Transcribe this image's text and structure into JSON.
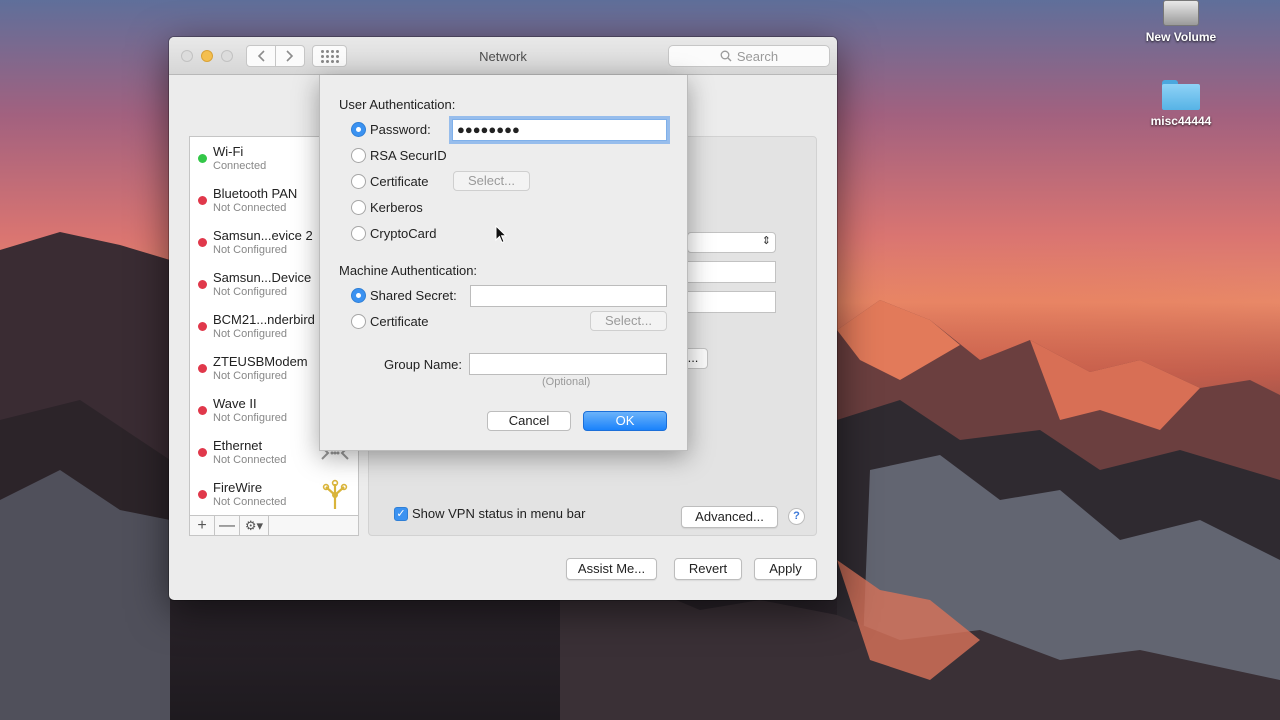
{
  "desktop": {
    "icons": [
      {
        "label": "New Volume",
        "icon": "disk-icon"
      },
      {
        "label": "misc44444",
        "icon": "folder-icon"
      }
    ]
  },
  "window": {
    "title": "Network",
    "search_placeholder": "Search"
  },
  "services": [
    {
      "name": "Wi-Fi",
      "status": "Connected",
      "color": "#33c748"
    },
    {
      "name": "Bluetooth PAN",
      "status": "Not Connected",
      "color": "#e0384b"
    },
    {
      "name": "Samsun...evice 2",
      "status": "Not Configured",
      "color": "#e0384b"
    },
    {
      "name": "Samsun...Device",
      "status": "Not Configured",
      "color": "#e0384b"
    },
    {
      "name": "BCM21...nderbird",
      "status": "Not Configured",
      "color": "#e0384b"
    },
    {
      "name": "ZTEUSBModem",
      "status": "Not Configured",
      "color": "#e0384b"
    },
    {
      "name": "Wave II",
      "status": "Not Configured",
      "color": "#e0384b"
    },
    {
      "name": "Ethernet",
      "status": "Not Connected",
      "color": "#e0384b"
    },
    {
      "name": "FireWire",
      "status": "Not Connected",
      "color": "#e0384b"
    }
  ],
  "list_toolbar": {
    "add": "+",
    "remove": "—",
    "gear": "⚙▾"
  },
  "detail": {
    "peek_button": "...",
    "show_vpn_status": "Show VPN status in menu bar",
    "show_vpn_checked": true,
    "advanced": "Advanced...",
    "help": "?"
  },
  "footer": {
    "assist": "Assist Me...",
    "revert": "Revert",
    "apply": "Apply"
  },
  "sheet": {
    "user_auth_title": "User Authentication:",
    "user_options": [
      {
        "label": "Password:",
        "selected": true
      },
      {
        "label": "RSA SecurID",
        "selected": false
      },
      {
        "label": "Certificate",
        "selected": false
      },
      {
        "label": "Kerberos",
        "selected": false
      },
      {
        "label": "CryptoCard",
        "selected": false
      }
    ],
    "password_value": "●●●●●●●●",
    "user_cert_select": "Select...",
    "machine_auth_title": "Machine Authentication:",
    "machine_options": [
      {
        "label": "Shared Secret:",
        "selected": true
      },
      {
        "label": "Certificate",
        "selected": false
      }
    ],
    "shared_secret_value": "",
    "machine_cert_select": "Select...",
    "group_name_label": "Group Name:",
    "group_name_value": "",
    "group_name_hint": "(Optional)",
    "cancel": "Cancel",
    "ok": "OK"
  }
}
